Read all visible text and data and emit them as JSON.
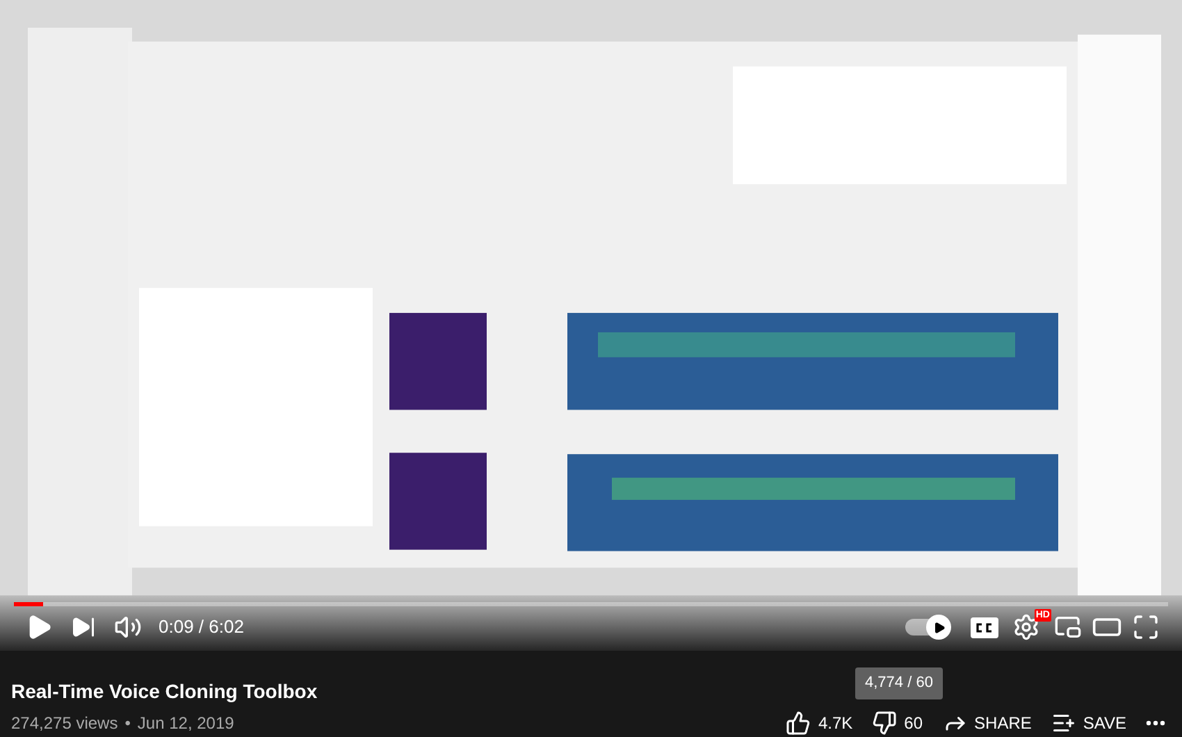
{
  "player": {
    "progress": {
      "level": 0.025
    },
    "time": "0:09 / 6:02",
    "autoplay": {
      "on": true
    },
    "settings_badge": "HD"
  },
  "video": {
    "title": "Real-Time Voice Cloning Toolbox",
    "views": "274,275 views",
    "separator": "•",
    "date": "Jun 12, 2019"
  },
  "tooltip": "4,774 / 60",
  "actions": [
    {
      "kind": "like",
      "label": "4.7K"
    },
    {
      "kind": "dislike",
      "label": "60"
    },
    {
      "kind": "share",
      "label": "SHARE"
    },
    {
      "kind": "save",
      "label": "SAVE"
    },
    {
      "kind": "more"
    }
  ]
}
